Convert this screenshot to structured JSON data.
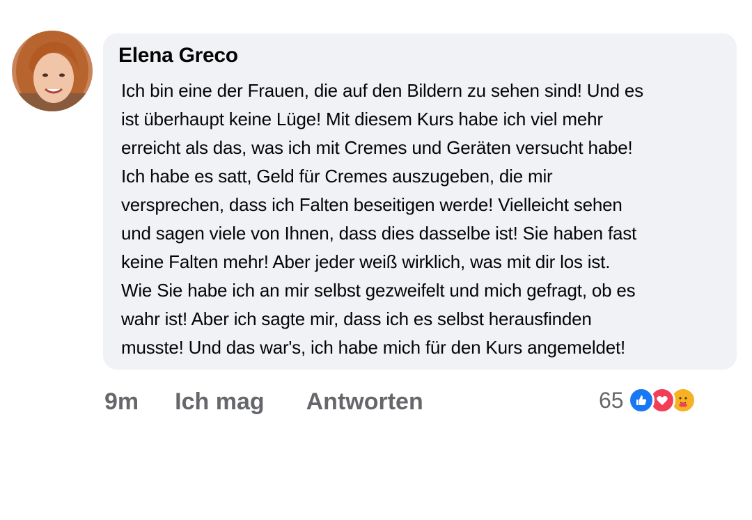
{
  "comment": {
    "author": "Elena Greco",
    "text": "Ich bin eine der Frauen, die auf den Bildern zu sehen sind! Und es\nist überhaupt keine Lüge! Mit diesem Kurs habe ich viel mehr\nerreicht als das, was ich mit Cremes und Geräten versucht habe!\nIch habe es satt, Geld für Cremes auszugeben, die mir\nversprechen, dass ich Falten beseitigen werde! Vielleicht sehen\nund sagen viele von Ihnen, dass dies dasselbe ist! Sie haben fast\nkeine Falten mehr! Aber jeder weiß wirklich, was mit dir los ist.\nWie Sie habe ich an mir selbst gezweifelt und mich gefragt, ob es\nwahr ist! Aber ich sagte mir, dass ich es selbst herausfinden\nmusste! Und das war's, ich habe mich für den Kurs angemeldet!"
  },
  "actions": {
    "time": "9m",
    "like_label": "Ich mag",
    "reply_label": "Antworten"
  },
  "reactions": {
    "count": "65",
    "icons": [
      "like-icon",
      "love-icon",
      "care-icon"
    ],
    "colors": {
      "like": "#1877f2",
      "love": "#f33e58",
      "care": "#f7b125"
    }
  },
  "colors": {
    "bubble": "#f0f2f5",
    "text": "#050505",
    "secondary": "#65676b"
  }
}
